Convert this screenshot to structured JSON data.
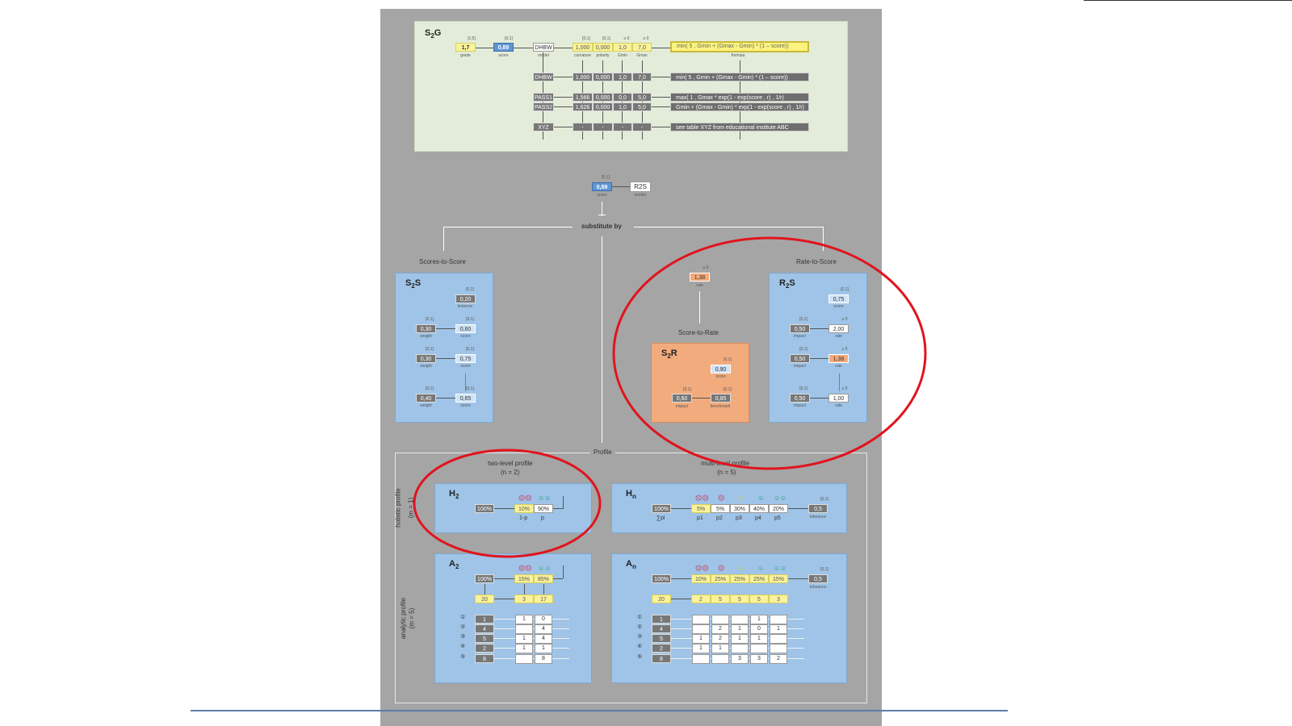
{
  "s2g": {
    "title_main": "S",
    "title_sub": "2",
    "title_end": "G",
    "grade": {
      "range": "[1;5]",
      "value": "1,7",
      "label": "grade"
    },
    "score": {
      "range": "[0,1]",
      "value": "0,89",
      "label": "score"
    },
    "model": {
      "value": "DHBW",
      "label": "model"
    },
    "header_ranges": [
      "[0,1]",
      "[0,1]",
      "≥ 0",
      "≥ 0"
    ],
    "header_values": [
      "1,000",
      "0,000",
      "1,0",
      "7,0"
    ],
    "header_labels": [
      "curvature",
      "polarity",
      "Gmin",
      "Gmax"
    ],
    "formula_header": "min( 5 , Gmin + (Gmax - Gmin) * (1 – score))",
    "formula_label": "formula",
    "rows": [
      {
        "model": "DHBW",
        "vals": [
          "1,000",
          "0,000",
          "1,0",
          "7,0"
        ],
        "formula": "min( 5 , Gmin + (Gmax - Gmin) * (1 – score))"
      },
      {
        "model": "PASS1",
        "vals": [
          "1,566",
          "0,000",
          "0,0",
          "5,0"
        ],
        "formula": "max( 1 , Gmax * exp(1 - exp(score , r) , 1/r)"
      },
      {
        "model": "PASS2",
        "vals": [
          "1,626",
          "0,000",
          "1,0",
          "5,0"
        ],
        "formula": "Gmin + (Gmax - Gmin) * exp(1 - exp(score , r) , 1/r)"
      },
      {
        "model": "XYZ",
        "vals": [
          "-",
          "-",
          "-",
          "-"
        ],
        "formula": "see table XYZ from educational institute ABC"
      }
    ]
  },
  "invoke": {
    "score_range": "[0,1]",
    "score": "0,89",
    "score_label": "score",
    "r2s": "R2S",
    "r2s_label": "invoke"
  },
  "substitute_by": "substitute by",
  "scores_to_score_title": "Scores-to-Score",
  "rate_to_score_title": "Rate-to-Score",
  "score_to_rate_title": "Score-to-Rate",
  "s2s": {
    "t1": "S",
    "t2": "2",
    "t3": "S",
    "lenience_range": "[0,1]",
    "lenience": "0,20",
    "lenience_label": "lenience",
    "rows": [
      {
        "w_range": "[0,1]",
        "w": "0,30",
        "w_label": "weight",
        "s_range": "[0,1]",
        "s": "0,60",
        "s_label": "score"
      },
      {
        "w_range": "[0,1]",
        "w": "0,30",
        "w_label": "weight",
        "s_range": "[0,1]",
        "s": "0,75",
        "s_label": "score"
      },
      {
        "w_range": "[0,1]",
        "w": "0,40",
        "w_label": "weight",
        "s_range": "[0,1]",
        "s": "0,65",
        "s_label": "score"
      }
    ]
  },
  "r2s": {
    "t1": "R",
    "t2": "2",
    "t3": "S",
    "score_range": "[0,1]",
    "score": "0,75",
    "score_label": "score",
    "rows": [
      {
        "i_range": "[0,1]",
        "i": "0,50",
        "i_label": "impact",
        "r_range": "≥ 0",
        "r": "2,00",
        "r_label": "rate"
      },
      {
        "i_range": "[0,1]",
        "i": "0,50",
        "i_label": "impact",
        "r_range": "≥ 0",
        "r": "1,38",
        "r_label": "rate"
      },
      {
        "i_range": "[0,1]",
        "i": "0,50",
        "i_label": "impact",
        "r_range": "≥ 0",
        "r": "1,00",
        "r_label": "rate"
      }
    ]
  },
  "rate_top": {
    "range": "≥ 0",
    "value": "1,38",
    "label": "rate"
  },
  "s2r": {
    "t1": "S",
    "t2": "2",
    "t3": "R",
    "score_range": "[0,1]",
    "score": "0,90",
    "score_label": "score",
    "impact_range": "[0,1]",
    "impact": "0,60",
    "impact_label": "impact",
    "bench_range": "[0,1]",
    "bench": "0,85",
    "bench_label": "benchmark"
  },
  "profile": {
    "title": "Profile",
    "two_level": "two-level profile",
    "two_level_n": "(n = 2)",
    "multi_level": "multi-level profile",
    "multi_level_n": "(n = 5)",
    "holistic": "holistic profile",
    "holistic_m": "(m = 1)",
    "analytic": "analytic profile",
    "analytic_m": "(m = 5)"
  },
  "h2": {
    "t1": "H",
    "t2": "2",
    "total": "100%",
    "smiles": [
      "☹☹",
      "☺☺"
    ],
    "vals": [
      "10%",
      "90%"
    ],
    "labels": [
      "1-p",
      "p"
    ]
  },
  "hn": {
    "t1": "H",
    "t2": "n",
    "total": "100%",
    "total_label": "∑pi",
    "smiles": [
      "☹☹",
      "☹",
      "☺",
      "☺",
      "☺☺"
    ],
    "vals": [
      "5%",
      "5%",
      "30%",
      "40%",
      "20%"
    ],
    "labels": [
      "p1",
      "p2",
      "p3",
      "p4",
      "p5"
    ],
    "tol_range": "[0,1]",
    "tol": "0,5",
    "tol_label": "tolerance"
  },
  "a2": {
    "t1": "A",
    "t2": "2",
    "total": "100%",
    "smiles": [
      "☹☹",
      "☺☺"
    ],
    "pct": [
      "15%",
      "85%"
    ],
    "count_total": "20",
    "counts": [
      "3",
      "17"
    ],
    "row_idx": [
      "①",
      "②",
      "③",
      "④",
      "⑤"
    ],
    "row_tot": [
      "1",
      "4",
      "5",
      "2",
      "8"
    ],
    "cells": [
      [
        "1",
        "0"
      ],
      [
        "",
        "4"
      ],
      [
        "1",
        "4"
      ],
      [
        "1",
        "1"
      ],
      [
        "",
        "8"
      ]
    ]
  },
  "an": {
    "t1": "A",
    "t2": "n",
    "total": "100%",
    "smiles": [
      "☹☹",
      "☹",
      "☺",
      "☺",
      "☺☺"
    ],
    "pct": [
      "10%",
      "25%",
      "25%",
      "25%",
      "15%"
    ],
    "count_total": "20",
    "counts": [
      "2",
      "5",
      "5",
      "5",
      "3"
    ],
    "tol_range": "[0,1]",
    "tol": "0,5",
    "tol_label": "tolerance",
    "row_idx": [
      "①",
      "②",
      "③",
      "④",
      "⑤"
    ],
    "row_tot": [
      "1",
      "4",
      "5",
      "2",
      "8"
    ],
    "cells": [
      [
        "",
        "",
        "",
        "1",
        ""
      ],
      [
        "",
        "2",
        "1",
        "0",
        "1"
      ],
      [
        "1",
        "2",
        "1",
        "1",
        ""
      ],
      [
        "1",
        "1",
        "",
        "",
        ""
      ],
      [
        "",
        "",
        "3",
        "3",
        "2"
      ]
    ]
  },
  "colors": {
    "annotation_circle": "#e0141e",
    "poster_bg": "#a5a5a5",
    "blue_panel": "#9fc4e8",
    "orange_panel": "#f2ab7d",
    "green_panel": "#e3ecd8"
  }
}
